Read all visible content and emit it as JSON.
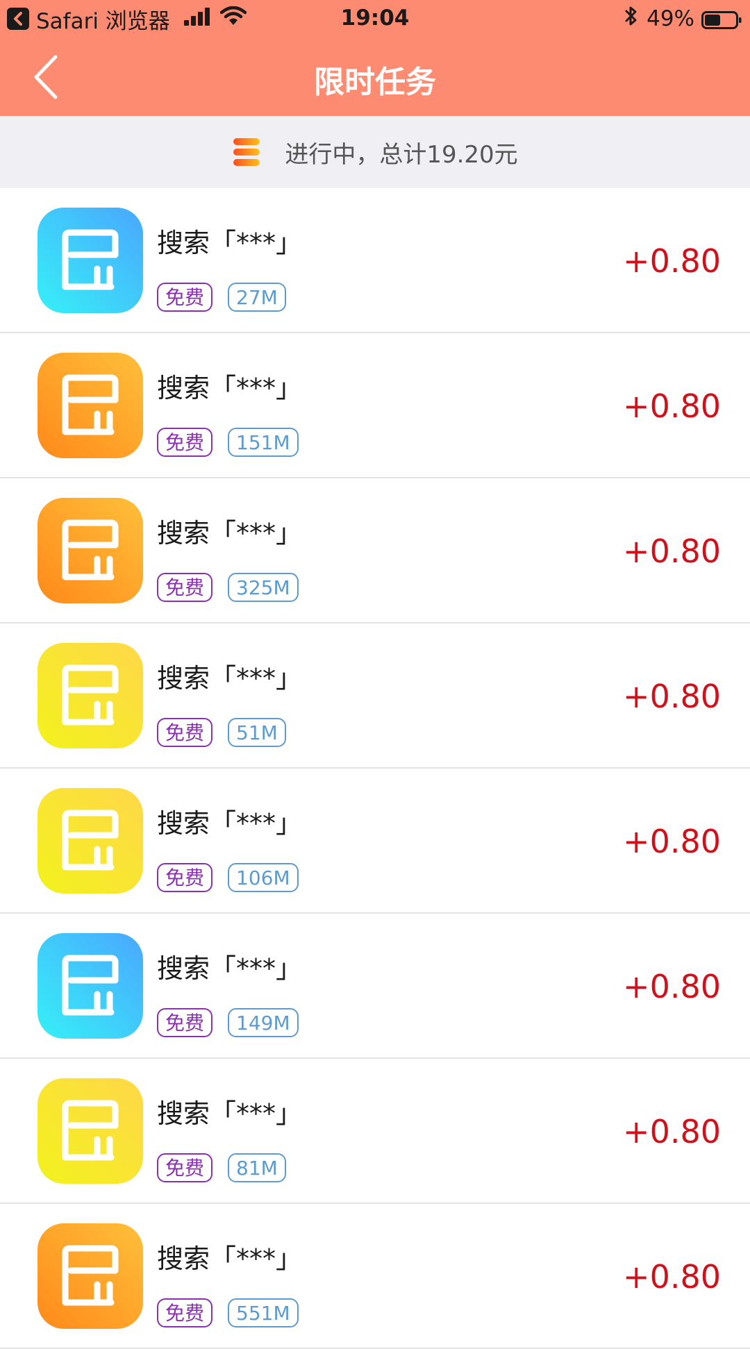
{
  "status_bar": {
    "app_name": "Safari 浏览器",
    "time": "19:04",
    "battery": "49%"
  },
  "nav": {
    "title": "限时任务"
  },
  "summary": {
    "text": "进行中，总计19.20元"
  },
  "colors": {
    "header": "#fc8b71",
    "reward": "#d0111b",
    "tag_free": "#8a2fb0",
    "tag_size": "#5b9bd1"
  },
  "tasks": [
    {
      "title": "搜索「***」",
      "tag_free": "免费",
      "size": "27M",
      "reward": "+0.80",
      "icon_color": "blue"
    },
    {
      "title": "搜索「***」",
      "tag_free": "免费",
      "size": "151M",
      "reward": "+0.80",
      "icon_color": "orange"
    },
    {
      "title": "搜索「***」",
      "tag_free": "免费",
      "size": "325M",
      "reward": "+0.80",
      "icon_color": "orange"
    },
    {
      "title": "搜索「***」",
      "tag_free": "免费",
      "size": "51M",
      "reward": "+0.80",
      "icon_color": "yellow"
    },
    {
      "title": "搜索「***」",
      "tag_free": "免费",
      "size": "106M",
      "reward": "+0.80",
      "icon_color": "yellow"
    },
    {
      "title": "搜索「***」",
      "tag_free": "免费",
      "size": "149M",
      "reward": "+0.80",
      "icon_color": "blue"
    },
    {
      "title": "搜索「***」",
      "tag_free": "免费",
      "size": "81M",
      "reward": "+0.80",
      "icon_color": "yellow"
    },
    {
      "title": "搜索「***」",
      "tag_free": "免费",
      "size": "551M",
      "reward": "+0.80",
      "icon_color": "orange"
    }
  ]
}
